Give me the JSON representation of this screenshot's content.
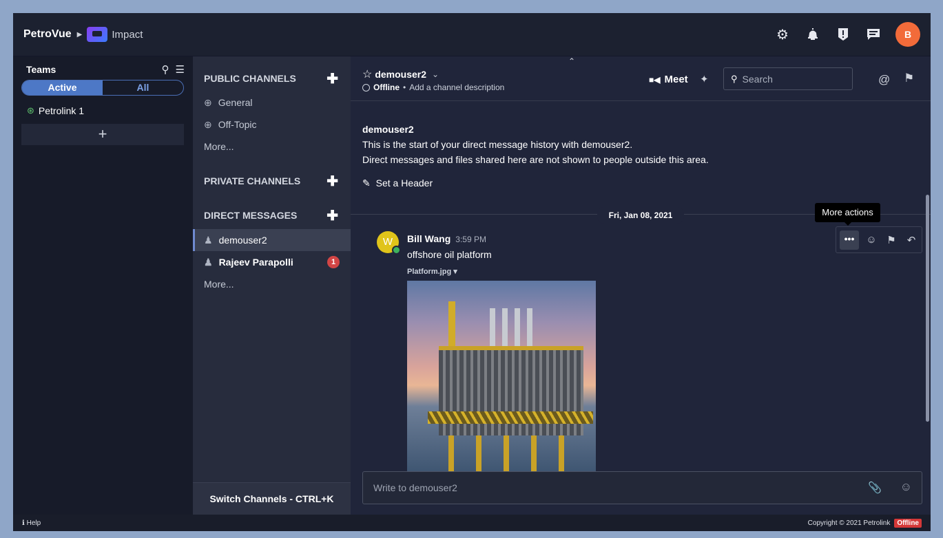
{
  "topbar": {
    "brand": "PetroVue",
    "app_name": "Impact",
    "icons": [
      "gear-icon",
      "bell-icon",
      "alert-icon",
      "chat-icon"
    ],
    "user_initial": "B"
  },
  "teams": {
    "title": "Teams",
    "toggle_active": "Active",
    "toggle_all": "All",
    "items": [
      {
        "label": "Petrolink 1"
      }
    ],
    "add_label": "+"
  },
  "channels": {
    "public_header": "PUBLIC CHANNELS",
    "public": [
      {
        "label": "General"
      },
      {
        "label": "Off-Topic"
      }
    ],
    "public_more": "More...",
    "private_header": "PRIVATE CHANNELS",
    "dm_header": "DIRECT MESSAGES",
    "dms": [
      {
        "label": "demouser2",
        "active": true
      },
      {
        "label": "Rajeev Parapolli",
        "unread": "1"
      }
    ],
    "dm_more": "More...",
    "switch_label": "Switch Channels - CTRL+K"
  },
  "channel_header": {
    "name": "demouser2",
    "status": "Offline",
    "separator": "•",
    "description_link": "Add a channel description",
    "meet_label": "Meet",
    "search_placeholder": "Search"
  },
  "intro": {
    "who": "demouser2",
    "line1": "This is the start of your direct message history with demouser2.",
    "line2": "Direct messages and files shared here are not shown to people outside this area.",
    "set_header": "Set a Header"
  },
  "messages": {
    "date": "Fri, Jan 08, 2021",
    "items": [
      {
        "author": "Bill Wang",
        "avatar_initial": "W",
        "time": "3:59 PM",
        "text": "offshore oil platform",
        "file": "Platform.jpg"
      }
    ],
    "tooltip": "More actions",
    "more_label": "•••"
  },
  "composer": {
    "placeholder": "Write to demouser2"
  },
  "footer": {
    "help": "Help",
    "copyright": "Copyright © 2021 Petrolink",
    "status": "Offline"
  },
  "colors": {
    "accent": "#4d78c6",
    "avatar_user": "#f26b3a",
    "badge": "#d24545",
    "online": "#3db25d"
  }
}
